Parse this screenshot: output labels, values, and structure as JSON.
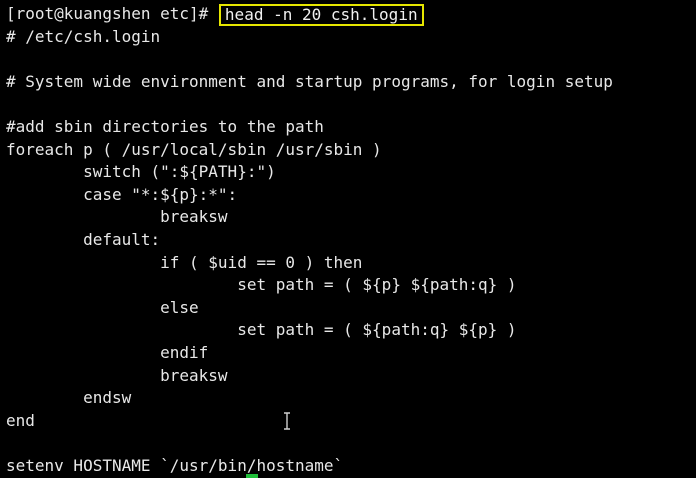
{
  "terminal": {
    "prompt": "[root@kuangshen etc]# ",
    "command": "head -n 20 csh.login",
    "colors": {
      "background": "#000000",
      "foreground": "#e8e8e8",
      "command_highlight": "#e6e600",
      "cursor": "#1fbf3a"
    },
    "output": [
      "# /etc/csh.login",
      "",
      "# System wide environment and startup programs, for login setup",
      "",
      "#add sbin directories to the path",
      "foreach p ( /usr/local/sbin /usr/sbin )",
      "        switch (\":${PATH}:\")",
      "        case \"*:${p}:*\":",
      "                breaksw",
      "        default:",
      "                if ( $uid == 0 ) then",
      "                        set path = ( ${p} ${path:q} )",
      "                else",
      "                        set path = ( ${path:q} ${p} )",
      "                endif",
      "                breaksw",
      "        endsw",
      "end",
      "",
      "setenv HOSTNAME `/usr/bin/hostname`"
    ],
    "mouse_pointer_icon": "ibeam-cursor-icon",
    "text_cursor_icon": "block-cursor-icon"
  }
}
